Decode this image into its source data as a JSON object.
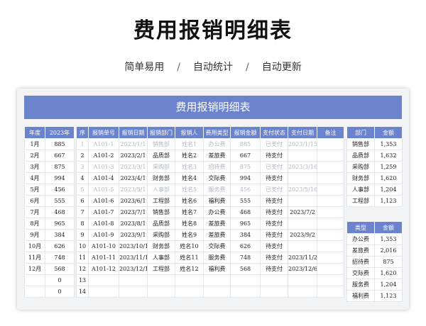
{
  "page": {
    "title": "费用报销明细表",
    "subnav": [
      "简单易用",
      "自动统计",
      "自动更新"
    ],
    "separator": "/"
  },
  "sheet": {
    "banner": "费用报销明细表",
    "year_table": {
      "headers": [
        "年度",
        "2023年"
      ],
      "rows": [
        [
          "1月",
          "885"
        ],
        [
          "2月",
          "667"
        ],
        [
          "3月",
          "875"
        ],
        [
          "4月",
          "994"
        ],
        [
          "5月",
          "456"
        ],
        [
          "6月",
          "555"
        ],
        [
          "7月",
          "468"
        ],
        [
          "8月",
          "965"
        ],
        [
          "9月",
          "384"
        ],
        [
          "10月",
          "626"
        ],
        [
          "11月",
          "748"
        ],
        [
          "12月",
          "568"
        ],
        [
          "",
          "0"
        ],
        [
          "",
          "0"
        ]
      ]
    },
    "main_table": {
      "headers": [
        "序",
        "报销单号",
        "报销日期",
        "报销部门",
        "报销人",
        "费用类型",
        "报销金额",
        "支付状态",
        "支付日期",
        "备注"
      ],
      "rows": [
        {
          "faded": true,
          "cells": [
            "1",
            "A101-1",
            "2023/1/1",
            "销售部",
            "姓名1",
            "办公费",
            "885",
            "已支付",
            "2023/1/15",
            ""
          ]
        },
        {
          "faded": false,
          "cells": [
            "2",
            "A101-2",
            "2023/2/1",
            "品质部",
            "姓名2",
            "差旅费",
            "667",
            "待支付",
            "",
            ""
          ]
        },
        {
          "faded": true,
          "cells": [
            "3",
            "A101-3",
            "2023/3/1",
            "采购部",
            "姓名3",
            "招待费",
            "875",
            "已支付",
            "2023/3/16",
            ""
          ]
        },
        {
          "faded": false,
          "cells": [
            "4",
            "A101-4",
            "2023/4/1",
            "财务部",
            "姓名4",
            "交际费",
            "994",
            "待支付",
            "",
            ""
          ]
        },
        {
          "faded": true,
          "cells": [
            "5",
            "A101-5",
            "2023/5/1",
            "人事部",
            "姓名5",
            "服务费",
            "456",
            "已支付",
            "2023/5/16",
            ""
          ]
        },
        {
          "faded": false,
          "cells": [
            "6",
            "A101-6",
            "2023/6/1",
            "工程部",
            "姓名6",
            "福利费",
            "555",
            "待支付",
            "",
            ""
          ]
        },
        {
          "faded": false,
          "cells": [
            "7",
            "A101-7",
            "2023/7/1",
            "销售部",
            "姓名7",
            "办公费",
            "468",
            "待支付",
            "2023/7/2",
            ""
          ]
        },
        {
          "faded": false,
          "cells": [
            "8",
            "A101-8",
            "2023/8/1",
            "品质部",
            "姓名8",
            "差旅费",
            "965",
            "待支付",
            "",
            ""
          ]
        },
        {
          "faded": false,
          "cells": [
            "9",
            "A101-9",
            "2023/9/1",
            "采购部",
            "姓名9",
            "差旅费",
            "384",
            "待支付",
            "2023/9/2",
            ""
          ]
        },
        {
          "faded": false,
          "cells": [
            "10",
            "A101-10",
            "2023/10/1",
            "财务部",
            "姓名10",
            "交际费",
            "626",
            "待支付",
            "",
            ""
          ]
        },
        {
          "faded": false,
          "cells": [
            "11",
            "A101-11",
            "2023/11/1",
            "人事部",
            "姓名11",
            "服务费",
            "748",
            "待支付",
            "2023/11/2",
            ""
          ]
        },
        {
          "faded": false,
          "cells": [
            "12",
            "A101-12",
            "2023/12/1",
            "工程部",
            "姓名12",
            "福利费",
            "568",
            "待支付",
            "2023/12/6",
            ""
          ]
        },
        {
          "faded": false,
          "cells": [
            "13",
            "",
            "",
            "",
            "",
            "",
            "",
            "",
            "",
            ""
          ]
        },
        {
          "faded": false,
          "cells": [
            "14",
            "",
            "",
            "",
            "",
            "",
            "",
            "",
            "",
            ""
          ]
        }
      ]
    },
    "dept_table": {
      "headers": [
        "部门",
        "金额"
      ],
      "rows": [
        [
          "销售部",
          "1,353"
        ],
        [
          "品质部",
          "1,632"
        ],
        [
          "采购部",
          "1,259"
        ],
        [
          "财务部",
          "1,620"
        ],
        [
          "人事部",
          "1,204"
        ],
        [
          "工程部",
          "1,123"
        ]
      ]
    },
    "type_table": {
      "headers": [
        "类型",
        "金额"
      ],
      "rows": [
        [
          "办公费",
          "1,353"
        ],
        [
          "差旅费",
          "2,016"
        ],
        [
          "招待费",
          "875"
        ],
        [
          "交际费",
          "1,620"
        ],
        [
          "服务费",
          "1,204"
        ],
        [
          "福利费",
          "1,123"
        ]
      ]
    }
  },
  "colors": {
    "accent": "#6b82cc",
    "panel_bg": "#f2f3f5",
    "faded_text": "#b0b6c2"
  }
}
